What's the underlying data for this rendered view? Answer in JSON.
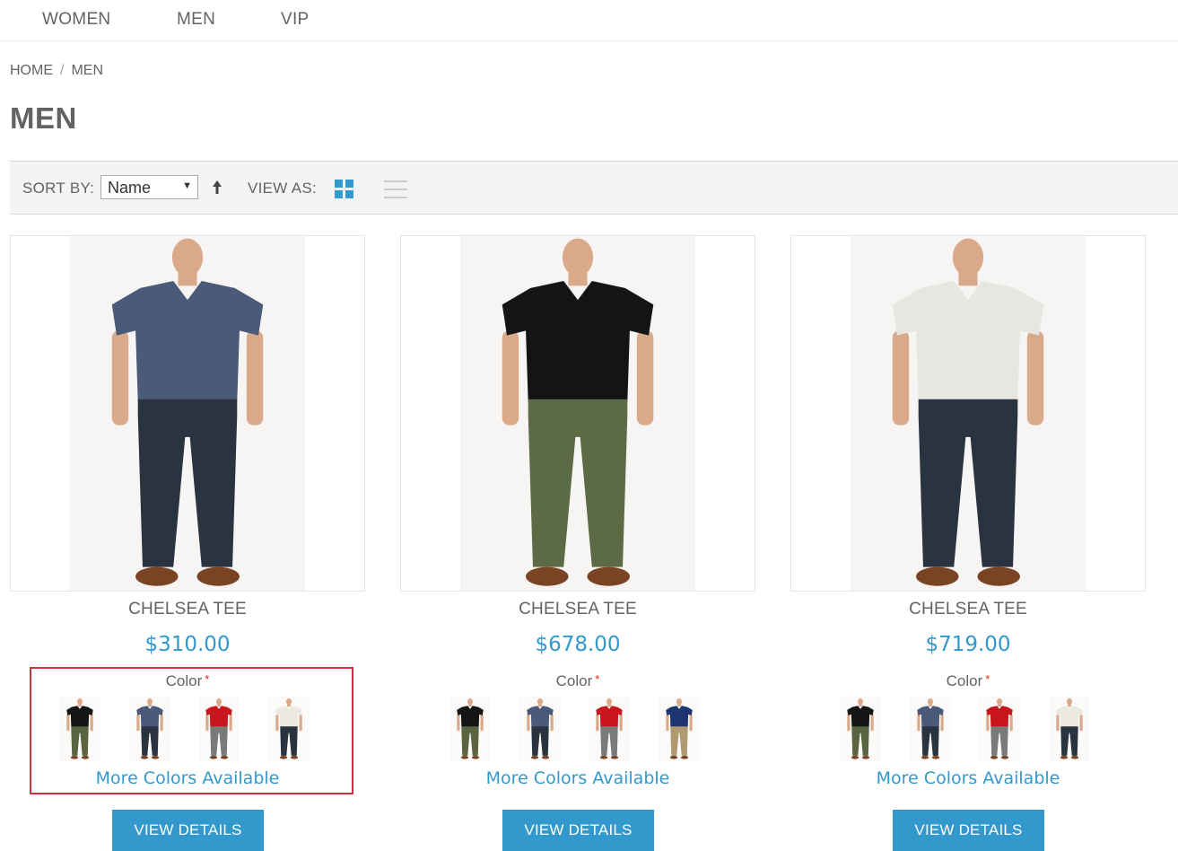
{
  "nav": {
    "items": [
      {
        "label": "WOMEN"
      },
      {
        "label": "MEN"
      },
      {
        "label": "VIP"
      }
    ]
  },
  "breadcrumb": {
    "home": "HOME",
    "separator": "/",
    "current": "MEN"
  },
  "page": {
    "title": "MEN"
  },
  "toolbar": {
    "sort_label": "SORT BY:",
    "sort_value": "Name",
    "view_label": "VIEW AS:"
  },
  "colors": {
    "accent": "#3399cc",
    "required": "#df280a",
    "highlight": "#d4313f",
    "text": "#636363"
  },
  "products": [
    {
      "name": "CHELSEA TEE",
      "price": "$310.00",
      "color_label": "Color",
      "required_mark": "*",
      "shirt_color": "#4a5a78",
      "pants_color": "#2a3340",
      "swatches": [
        {
          "shirt": "#151515",
          "pants": "#5a6540"
        },
        {
          "shirt": "#4a5a78",
          "pants": "#2a3340"
        },
        {
          "shirt": "#c8161e",
          "pants": "#7a7a7a"
        },
        {
          "shirt": "#ece9e2",
          "pants": "#2a3340"
        }
      ],
      "more_link": "More Colors Available",
      "button": "VIEW DETAILS"
    },
    {
      "name": "CHELSEA TEE",
      "price": "$678.00",
      "color_label": "Color",
      "required_mark": "*",
      "shirt_color": "#141414",
      "pants_color": "#5c6a45",
      "swatches": [
        {
          "shirt": "#151515",
          "pants": "#5a6540"
        },
        {
          "shirt": "#4a5a78",
          "pants": "#2a3340"
        },
        {
          "shirt": "#c8161e",
          "pants": "#7a7a7a"
        },
        {
          "shirt": "#1c3470",
          "pants": "#b09a70"
        }
      ],
      "more_link": "More Colors Available",
      "button": "VIEW DETAILS"
    },
    {
      "name": "CHELSEA TEE",
      "price": "$719.00",
      "color_label": "Color",
      "required_mark": "*",
      "shirt_color": "#e8e6e1",
      "pants_color": "#2a3340",
      "swatches": [
        {
          "shirt": "#151515",
          "pants": "#5a6540"
        },
        {
          "shirt": "#4a5a78",
          "pants": "#2a3340"
        },
        {
          "shirt": "#c8161e",
          "pants": "#7a7a7a"
        },
        {
          "shirt": "#ece9e2",
          "pants": "#2a3340"
        }
      ],
      "more_link": "More Colors Available",
      "button": "VIEW DETAILS"
    }
  ]
}
